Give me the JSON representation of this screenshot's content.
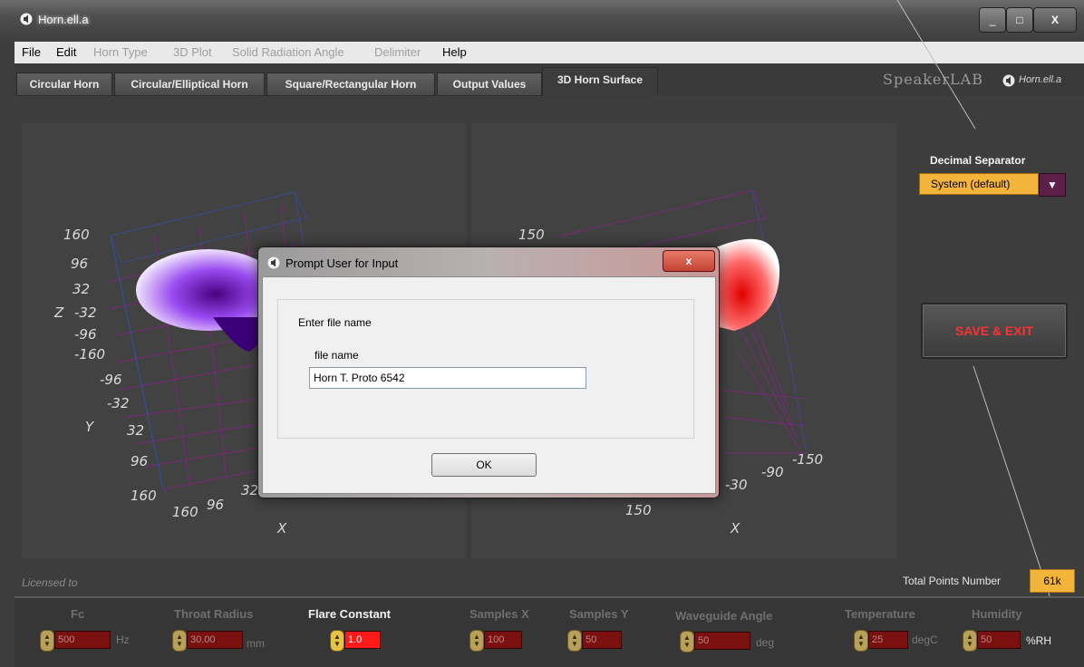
{
  "window": {
    "title": "Horn.ell.a",
    "minimize": "_",
    "maximize": "□",
    "close": "X"
  },
  "menu": {
    "items": [
      {
        "label": "File",
        "enabled": true
      },
      {
        "label": "Edit",
        "enabled": true
      },
      {
        "label": "Horn Type",
        "enabled": false
      },
      {
        "label": "3D Plot",
        "enabled": false
      },
      {
        "label": "Solid Radiation Angle",
        "enabled": false
      },
      {
        "label": "Delimiter",
        "enabled": false
      },
      {
        "label": "Help",
        "enabled": true
      }
    ]
  },
  "tabs": [
    {
      "label": "Circular Horn"
    },
    {
      "label": "Circular/Elliptical Horn"
    },
    {
      "label": "Square/Rectangular Horn"
    },
    {
      "label": "Output Values"
    },
    {
      "label": "3D Horn Surface",
      "active": true
    }
  ],
  "branding": {
    "logo": "SpeakerLAB",
    "app": "Horn.ell.a"
  },
  "plots": {
    "left": {
      "z_ticks": [
        "160",
        "96",
        "32",
        "-32",
        "-96",
        "-160"
      ],
      "z_label": "Z",
      "y_ticks": [
        "-96",
        "-32",
        "32",
        "96",
        "160"
      ],
      "y_label": "Y",
      "x_ticks": [
        "160",
        "96",
        "32"
      ],
      "x_label": "X"
    },
    "right": {
      "z_ticks": [
        "150"
      ],
      "x_ticks": [
        "150",
        "-30",
        "-90",
        "-150"
      ],
      "x_label": "X"
    },
    "colors": {
      "left_surface": "#6a00d8",
      "right_surface": "#e00000",
      "grid": "#7a2a7a"
    }
  },
  "decimal_separator": {
    "label": "Decimal Separator",
    "value": "System (default)"
  },
  "save_exit": {
    "label": "SAVE & EXIT"
  },
  "licensed": "Licensed to",
  "total_points": {
    "label": "Total Points Number",
    "value": "61k"
  },
  "controls": [
    {
      "label": "Fc",
      "value": "500",
      "unit": "Hz",
      "enabled": false
    },
    {
      "label": "Throat Radius",
      "value": "30.00",
      "unit": "mm",
      "enabled": false
    },
    {
      "label": "Flare Constant",
      "value": "1.0",
      "unit": "",
      "enabled": true
    },
    {
      "label": "Samples X",
      "value": "100",
      "unit": "",
      "enabled": false
    },
    {
      "label": "Samples Y",
      "value": "50",
      "unit": "",
      "enabled": false
    },
    {
      "label": "Waveguide Angle",
      "value": "50",
      "unit": "deg",
      "enabled": false
    },
    {
      "label": "Temperature",
      "value": "25",
      "unit": "degC",
      "enabled": false
    },
    {
      "label": "Humidity",
      "value": "50",
      "unit": "%RH",
      "enabled": false
    }
  ],
  "dialog": {
    "title": "Prompt User for Input",
    "close": "x",
    "prompt": "Enter file name",
    "field_label": "file name",
    "field_value": "Horn T. Proto 6542",
    "ok": "OK"
  }
}
